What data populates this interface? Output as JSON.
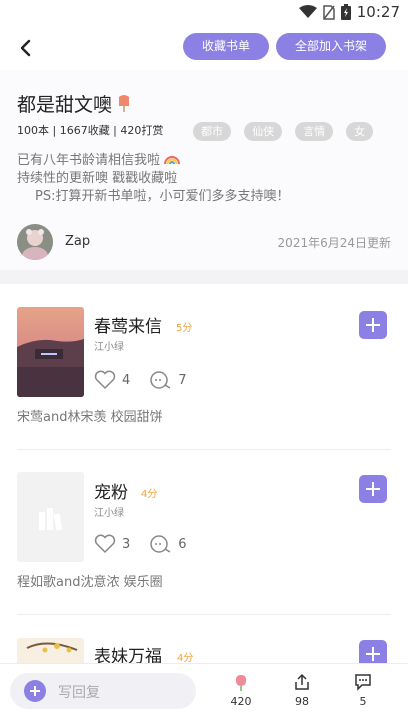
{
  "status_bar": {
    "time": "10:27"
  },
  "topbar": {
    "collect_label": "收藏书单",
    "add_all_label": "全部加入书架"
  },
  "booklist": {
    "title": "都是甜文噢",
    "stats": "100本 | 1667收藏 | 420打赏",
    "tags": [
      "都市",
      "仙侠",
      "言情",
      "女"
    ],
    "description": [
      "已有八年书龄请相信我啦",
      "持续性的更新噢 戳戳收藏啦",
      "PS:打算开新书单啦，小可爱们多多支持噢！"
    ],
    "author": "Zap",
    "updated": "2021年6月24日更新"
  },
  "books": [
    {
      "title": "春莺来信",
      "score": "5分",
      "author": "江小绿",
      "likes": "4",
      "comments": "7",
      "desc": "宋莺and林宋羡 校园甜饼"
    },
    {
      "title": "宠粉",
      "score": "4分",
      "author": "江小绿",
      "likes": "3",
      "comments": "6",
      "desc": "程如歌and沈意浓 娱乐圈"
    },
    {
      "title": "表妹万福",
      "score": "4分"
    }
  ],
  "bottom_bar": {
    "reply_placeholder": "写回复",
    "gifts": "420",
    "shares": "98",
    "comments": "5"
  },
  "colors": {
    "accent": "#8c80e4",
    "score": "#f0a43c",
    "tag": "#d7d7d7"
  }
}
